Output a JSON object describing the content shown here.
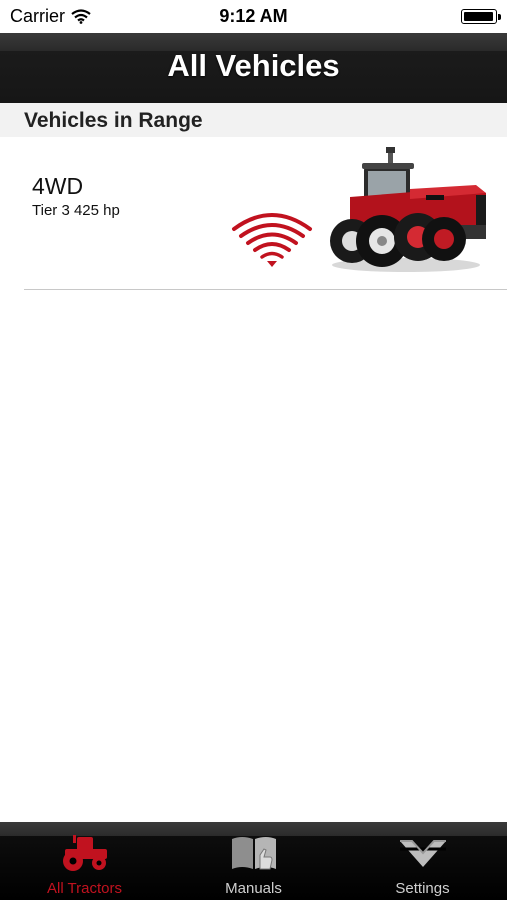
{
  "status_bar": {
    "carrier": "Carrier",
    "time": "9:12 AM",
    "battery_level": 1.0
  },
  "nav": {
    "title": "All Vehicles"
  },
  "section": {
    "header": "Vehicles in Range"
  },
  "vehicles": [
    {
      "name": "4WD",
      "description": "Tier 3 425 hp",
      "signal_icon": "wireless-signal-icon",
      "image": "red-4wd-tractor"
    }
  ],
  "tab_bar": {
    "tabs": [
      {
        "label": "All Tractors",
        "icon": "tractor-icon",
        "active": true
      },
      {
        "label": "Manuals",
        "icon": "book-icon",
        "active": false
      },
      {
        "label": "Settings",
        "icon": "brand-logo-icon",
        "active": false
      }
    ]
  },
  "colors": {
    "accent_red": "#c1121f",
    "nav_background": "#1b1b1b",
    "tab_inactive": "#cfcfcf",
    "section_background": "#f2f2f2"
  }
}
